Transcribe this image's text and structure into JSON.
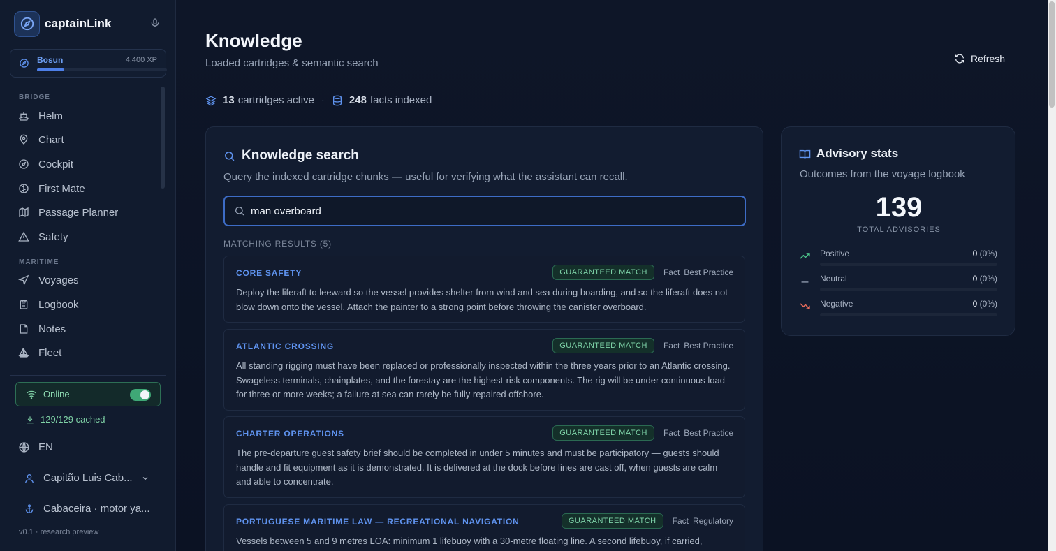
{
  "app": {
    "name": "captainLink",
    "version": "v0.1 · research preview"
  },
  "user_rank": {
    "rank": "Bosun",
    "xp": "4,400 XP",
    "progress": 0.21
  },
  "nav": {
    "sections": [
      {
        "label": "BRIDGE",
        "items": [
          {
            "label": "Helm",
            "icon": "ship-icon"
          },
          {
            "label": "Chart",
            "icon": "map-pin-icon"
          },
          {
            "label": "Cockpit",
            "icon": "compass-icon"
          },
          {
            "label": "First Mate",
            "icon": "brain-icon"
          },
          {
            "label": "Passage Planner",
            "icon": "map-icon"
          },
          {
            "label": "Safety",
            "icon": "warning-icon"
          }
        ]
      },
      {
        "label": "MARITIME",
        "items": [
          {
            "label": "Voyages",
            "icon": "navigation-icon"
          },
          {
            "label": "Logbook",
            "icon": "clipboard-icon"
          },
          {
            "label": "Notes",
            "icon": "note-icon"
          },
          {
            "label": "Fleet",
            "icon": "sailboat-icon"
          }
        ]
      }
    ]
  },
  "status": {
    "online_label": "Online",
    "online": true,
    "cached": "129/129 cached",
    "language": "EN",
    "captain": "Capitão Luis Cab...",
    "vessel": "Cabaceira · motor ya..."
  },
  "page": {
    "title": "Knowledge",
    "subtitle": "Loaded cartridges & semantic search",
    "refresh_label": "Refresh",
    "cartridges_count": "13",
    "cartridges_label": "cartridges active",
    "facts_count": "248",
    "facts_label": "facts indexed"
  },
  "search": {
    "title": "Knowledge search",
    "description": "Query the indexed cartridge chunks — useful for verifying what the assistant can recall.",
    "query": "man overboard",
    "results_label": "MATCHING RESULTS (5)",
    "results": [
      {
        "category": "CORE SAFETY",
        "badge": "GUARANTEED MATCH",
        "type": "Fact",
        "kind": "Best Practice",
        "text": "Deploy the liferaft to leeward so the vessel provides shelter from wind and sea during boarding, and so the liferaft does not blow down onto the vessel. Attach the painter to a strong point before throwing the canister overboard."
      },
      {
        "category": "ATLANTIC CROSSING",
        "badge": "GUARANTEED MATCH",
        "type": "Fact",
        "kind": "Best Practice",
        "text": "All standing rigging must have been replaced or professionally inspected within the three years prior to an Atlantic crossing. Swageless terminals, chainplates, and the forestay are the highest-risk components. The rig will be under continuous load for three or more weeks; a failure at sea can rarely be fully repaired offshore."
      },
      {
        "category": "CHARTER OPERATIONS",
        "badge": "GUARANTEED MATCH",
        "type": "Fact",
        "kind": "Best Practice",
        "text": "The pre-departure guest safety brief should be completed in under 5 minutes and must be participatory — guests should handle and fit equipment as it is demonstrated. It is delivered at the dock before lines are cast off, when guests are calm and able to concentrate."
      },
      {
        "category": "PORTUGUESE MARITIME LAW — RECREATIONAL NAVIGATION",
        "badge": "GUARANTEED MATCH",
        "type": "Fact",
        "kind": "Regulatory",
        "text": "Vessels between 5 and 9 metres LOA: minimum 1 lifebuoy with a 30-metre floating line. A second lifebuoy, if carried,"
      }
    ]
  },
  "advisory": {
    "title": "Advisory stats",
    "description": "Outcomes from the voyage logbook",
    "total": "139",
    "total_label": "TOTAL ADVISORIES",
    "rows": [
      {
        "name": "Positive",
        "count": "0",
        "pct": "(0%)",
        "color": "#4cc38a"
      },
      {
        "name": "Neutral",
        "count": "0",
        "pct": "(0%)",
        "color": "#8b96a9"
      },
      {
        "name": "Negative",
        "count": "0",
        "pct": "(0%)",
        "color": "#e46a5a"
      }
    ]
  },
  "colors": {
    "accent": "#4d7fe8",
    "match": "#7ed3a8",
    "background": "#0d1526"
  }
}
